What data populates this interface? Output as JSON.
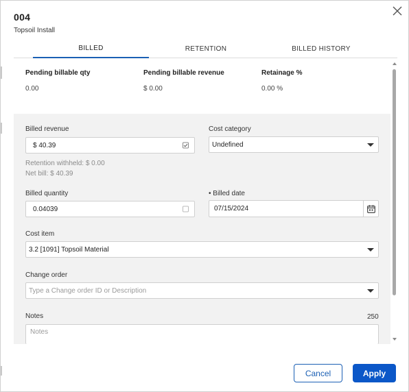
{
  "header": {
    "record_id": "004",
    "record_name": "Topsoil Install",
    "close_icon": "close-icon"
  },
  "tabs": [
    {
      "label": "BILLED",
      "active": true
    },
    {
      "label": "RETENTION",
      "active": false
    },
    {
      "label": "BILLED HISTORY",
      "active": false
    }
  ],
  "summary": {
    "pending_qty": {
      "label": "Pending billable qty",
      "value": "0.00"
    },
    "pending_revenue": {
      "label": "Pending billable revenue",
      "value": "$ 0.00"
    },
    "retainage": {
      "label": "Retainage %",
      "value": "0.00 %"
    }
  },
  "form": {
    "billed_revenue": {
      "label": "Billed revenue",
      "value": "$ 40.39",
      "icon": "checkbox-icon"
    },
    "retention_withheld": "Retention withheld: $ 0.00",
    "net_bill": "Net bill: $ 40.39",
    "cost_category": {
      "label": "Cost category",
      "value": "Undefined"
    },
    "billed_quantity": {
      "label": "Billed quantity",
      "value": "0.04039",
      "icon": "checkbox-icon"
    },
    "billed_date": {
      "label": "• Billed date",
      "value": "07/15/2024",
      "icon": "calendar-icon"
    },
    "cost_item": {
      "label": "Cost item",
      "value": "3.2 [1091] Topsoil Material"
    },
    "change_order": {
      "label": "Change order",
      "placeholder": "Type a Change order ID or Description"
    },
    "notes": {
      "label": "Notes",
      "counter": "250",
      "placeholder": "Notes"
    }
  },
  "footer": {
    "cancel_label": "Cancel",
    "apply_label": "Apply"
  },
  "colors": {
    "accent": "#0b57c8",
    "tab_underline": "#1a5fb4",
    "panel_background": "#f2f2f2"
  }
}
